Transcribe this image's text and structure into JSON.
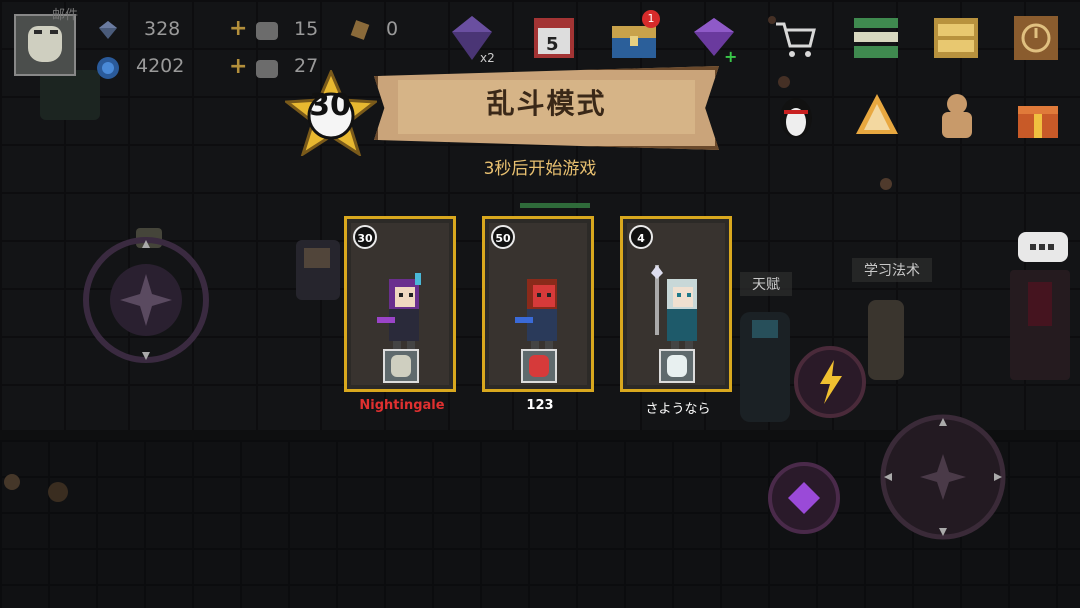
{
  "hud": {
    "avatar_label": "邮件",
    "gems": "328",
    "gems_add": "15",
    "energy": "0",
    "coins": "4202",
    "coins_add": "27"
  },
  "top_icons": [
    {
      "name": "gem-double-icon",
      "color": "#5a3f8a"
    },
    {
      "name": "calendar-icon",
      "color": "#c03a3a"
    },
    {
      "name": "treasure-chest-icon",
      "color": "#2f6fb0",
      "badge": "1"
    },
    {
      "name": "diamond-plus-icon",
      "color": "#7a3fae"
    },
    {
      "name": "shop-cart-icon",
      "color": "#ffffff"
    },
    {
      "name": "stack-icon",
      "color": "#4f9a5a"
    },
    {
      "name": "drawer-icon",
      "color": "#c8a24b"
    },
    {
      "name": "clock-book-icon",
      "color": "#9a6a3a"
    }
  ],
  "mode": {
    "title": "乱斗模式",
    "level": "30",
    "countdown": "3秒后开始游戏"
  },
  "players": [
    {
      "name": "Nightingale",
      "level": "30",
      "name_color": "#e03030",
      "accent": "#9a44c8",
      "skin": "#f0d8c0",
      "hair": "#6a2f8e"
    },
    {
      "name": "123",
      "level": "50",
      "name_color": "#ffffff",
      "accent": "#3a6ad8",
      "skin": "#d63a3a",
      "hair": "#8a2a1a"
    },
    {
      "name": "さようなら",
      "level": "4",
      "name_color": "#ffffff",
      "accent": "#1e7a8a",
      "skin": "#f0e0d0",
      "hair": "#c8d8d8"
    }
  ],
  "side": {
    "talent_label": "天赋",
    "learn_label": "学习法术"
  }
}
